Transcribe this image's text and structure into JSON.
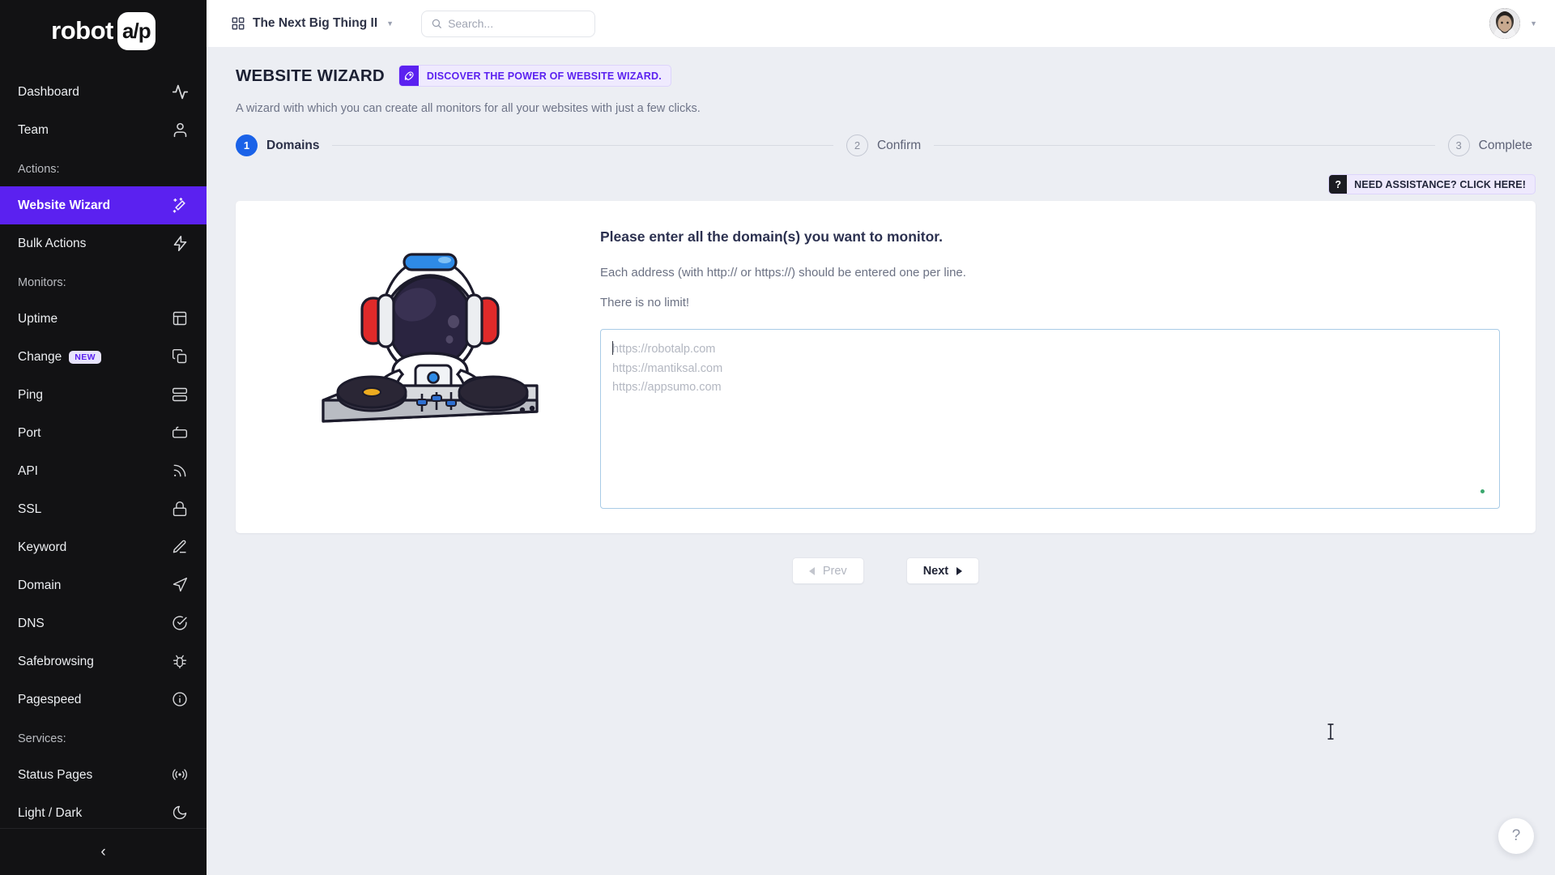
{
  "brand": {
    "logo_text": "robot",
    "logo_mark_text": "a/p"
  },
  "sidebar": {
    "groups": [
      {
        "label": "",
        "items": [
          {
            "label": "Dashboard",
            "icon": "activity-icon",
            "active": false
          },
          {
            "label": "Team",
            "icon": "user-icon",
            "active": false
          }
        ]
      },
      {
        "label": "Actions:",
        "items": [
          {
            "label": "Website Wizard",
            "icon": "wand-icon",
            "active": true
          },
          {
            "label": "Bulk Actions",
            "icon": "bolt-icon",
            "active": false
          }
        ]
      },
      {
        "label": "Monitors:",
        "items": [
          {
            "label": "Uptime",
            "icon": "layout-icon",
            "active": false
          },
          {
            "label": "Change",
            "icon": "copy-icon",
            "active": false,
            "badge": "NEW"
          },
          {
            "label": "Ping",
            "icon": "server-icon",
            "active": false
          },
          {
            "label": "Port",
            "icon": "plug-icon",
            "active": false
          },
          {
            "label": "API",
            "icon": "rss-icon",
            "active": false
          },
          {
            "label": "SSL",
            "icon": "lock-icon",
            "active": false
          },
          {
            "label": "Keyword",
            "icon": "pen-icon",
            "active": false
          },
          {
            "label": "Domain",
            "icon": "navigation-icon",
            "active": false
          },
          {
            "label": "DNS",
            "icon": "check-circle-icon",
            "active": false
          },
          {
            "label": "Safebrowsing",
            "icon": "bug-icon",
            "active": false
          },
          {
            "label": "Pagespeed",
            "icon": "info-circle-icon",
            "active": false
          }
        ]
      },
      {
        "label": "Services:",
        "items": [
          {
            "label": "Status Pages",
            "icon": "broadcast-icon",
            "active": false
          },
          {
            "label": "Light / Dark",
            "icon": "moon-icon",
            "active": false
          }
        ]
      }
    ],
    "collapse_icon": "chevron-left-icon"
  },
  "topbar": {
    "project_name": "The Next Big Thing II",
    "project_icon": "grid-icon",
    "project_caret": "chevron-down-icon",
    "search_placeholder": "Search...",
    "search_icon": "search-icon",
    "avatar_caret": "chevron-down-icon"
  },
  "page": {
    "title": "WEBSITE WIZARD",
    "promo_badge": {
      "icon": "rocket-icon",
      "text": "DISCOVER THE POWER OF WEBSITE WIZARD."
    },
    "subtitle": "A wizard with which you can create all monitors for all your websites with just a few clicks.",
    "assistance": {
      "icon": "question-mark-icon",
      "text": "NEED ASSISTANCE? CLICK HERE!"
    }
  },
  "stepper": {
    "steps": [
      {
        "number": "1",
        "label": "Domains",
        "state": "done"
      },
      {
        "number": "2",
        "label": "Confirm",
        "state": "todo"
      },
      {
        "number": "3",
        "label": "Complete",
        "state": "todo"
      }
    ]
  },
  "card": {
    "illustration": "astronaut-dj-illustration",
    "title": "Please enter all the domain(s) you want to monitor.",
    "line1": "Each address (with http:// or https://) should be entered one per line.",
    "line2": "There is no limit!",
    "textarea_value": "",
    "textarea_placeholder": "https://robotalp.com\nhttps://mantiksal.com\nhttps://appsumo.com"
  },
  "footer_nav": {
    "prev_label": "Prev",
    "next_label": "Next",
    "prev_icon": "triangle-left-icon",
    "next_icon": "triangle-right-icon"
  },
  "help_fab": {
    "icon": "question-mark-icon",
    "label": "?"
  },
  "colors": {
    "accent_purple": "#5b21f0",
    "step_blue": "#1a62e8",
    "sidebar_bg": "#121214",
    "page_bg": "#eceef3",
    "status_green": "#3aa76d"
  }
}
